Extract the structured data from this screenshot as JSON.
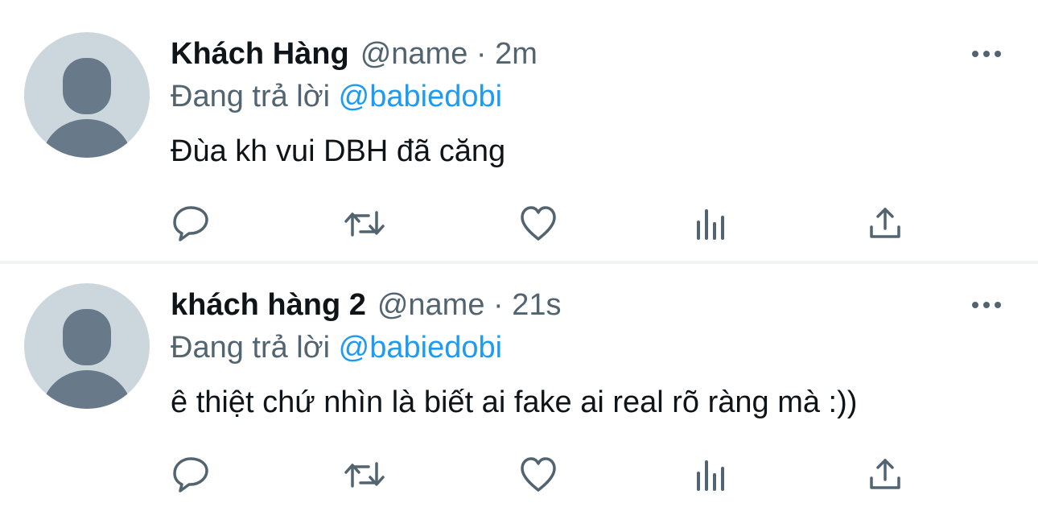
{
  "colors": {
    "text_primary": "#0f1419",
    "text_secondary": "#536471",
    "mention": "#1d9bf0",
    "avatar_bg": "#ccd6dd",
    "avatar_fg": "#687a8a",
    "divider": "#eff3f4"
  },
  "replies": [
    {
      "display_name": "Khách Hàng",
      "handle": "@name",
      "separator": "·",
      "time": "2m",
      "replying_label": "Đang trả lời",
      "replying_to": "@babiedobi",
      "text": "Đùa kh vui DBH đã căng",
      "icons": {
        "more": "more-horizontal-icon",
        "reply": "reply-icon",
        "retweet": "retweet-icon",
        "like": "like-icon",
        "views": "views-icon",
        "share": "share-icon"
      }
    },
    {
      "display_name": "khách hàng 2",
      "handle": "@name",
      "separator": "·",
      "time": "21s",
      "replying_label": "Đang trả lời",
      "replying_to": "@babiedobi",
      "text": "ê thiệt chứ nhìn là biết ai fake ai real rõ ràng mà :))",
      "icons": {
        "more": "more-horizontal-icon",
        "reply": "reply-icon",
        "retweet": "retweet-icon",
        "like": "like-icon",
        "views": "views-icon",
        "share": "share-icon"
      }
    }
  ]
}
